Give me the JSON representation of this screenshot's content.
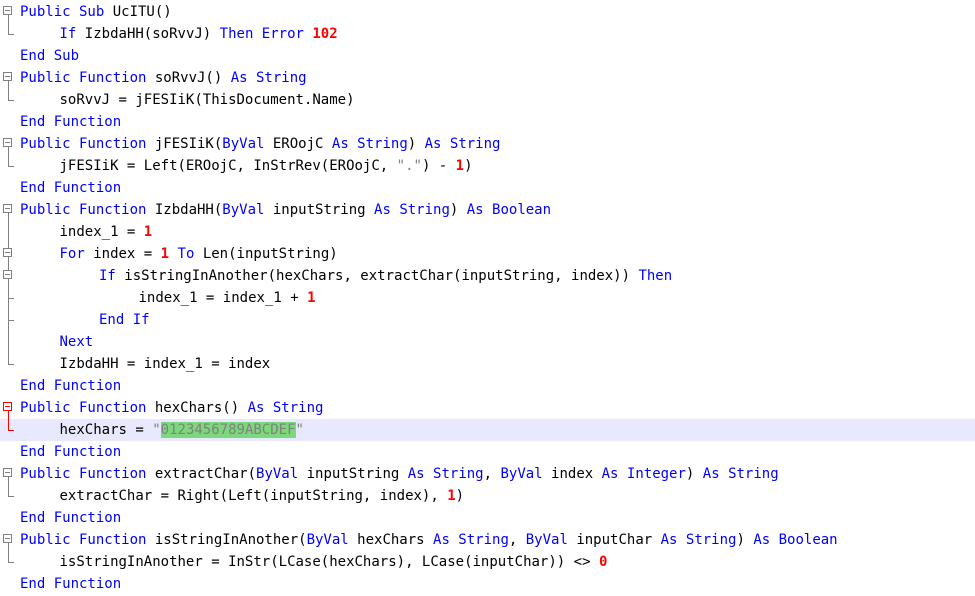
{
  "editor": {
    "lines": [
      {
        "indent": 0,
        "tokens": [
          [
            "kw",
            "Public Sub "
          ],
          [
            "t",
            "UcITU()"
          ]
        ]
      },
      {
        "indent": 1,
        "tokens": [
          [
            "kw",
            "If "
          ],
          [
            "t",
            "IzbdaHH(soRvvJ) "
          ],
          [
            "kw",
            "Then Error "
          ],
          [
            "num",
            "102"
          ]
        ]
      },
      {
        "indent": 0,
        "tokens": [
          [
            "kw",
            "End Sub"
          ]
        ]
      },
      {
        "indent": 0,
        "tokens": [
          [
            "kw",
            "Public Function "
          ],
          [
            "t",
            "soRvvJ() "
          ],
          [
            "kw",
            "As String"
          ]
        ]
      },
      {
        "indent": 1,
        "tokens": [
          [
            "t",
            "soRvvJ = jFESIiK(ThisDocument.Name)"
          ]
        ]
      },
      {
        "indent": 0,
        "tokens": [
          [
            "kw",
            "End Function"
          ]
        ]
      },
      {
        "indent": 0,
        "tokens": [
          [
            "kw",
            "Public Function "
          ],
          [
            "t",
            "jFESIiK("
          ],
          [
            "kw",
            "ByVal "
          ],
          [
            "t",
            "EROojC "
          ],
          [
            "kw",
            "As String"
          ],
          [
            "t",
            ") "
          ],
          [
            "kw",
            "As String"
          ]
        ]
      },
      {
        "indent": 1,
        "tokens": [
          [
            "t",
            "jFESIiK = Left(EROojC, InStrRev(EROojC, "
          ],
          [
            "str",
            "\".\""
          ],
          [
            "t",
            ") - "
          ],
          [
            "num",
            "1"
          ],
          [
            "t",
            ")"
          ]
        ]
      },
      {
        "indent": 0,
        "tokens": [
          [
            "kw",
            "End Function"
          ]
        ]
      },
      {
        "indent": 0,
        "tokens": [
          [
            "kw",
            "Public Function "
          ],
          [
            "t",
            "IzbdaHH("
          ],
          [
            "kw",
            "ByVal "
          ],
          [
            "t",
            "inputString "
          ],
          [
            "kw",
            "As String"
          ],
          [
            "t",
            ") "
          ],
          [
            "kw",
            "As Boolean"
          ]
        ]
      },
      {
        "indent": 1,
        "tokens": [
          [
            "t",
            "index_1 = "
          ],
          [
            "num",
            "1"
          ]
        ]
      },
      {
        "indent": 1,
        "tokens": [
          [
            "kw",
            "For "
          ],
          [
            "t",
            "index = "
          ],
          [
            "num",
            "1"
          ],
          [
            "kw",
            " To "
          ],
          [
            "t",
            "Len(inputString)"
          ]
        ]
      },
      {
        "indent": 2,
        "tokens": [
          [
            "kw",
            "If "
          ],
          [
            "t",
            "isStringInAnother(hexChars, extractChar(inputString, index)) "
          ],
          [
            "kw",
            "Then"
          ]
        ]
      },
      {
        "indent": 3,
        "tokens": [
          [
            "t",
            "index_1 = index_1 + "
          ],
          [
            "num",
            "1"
          ]
        ]
      },
      {
        "indent": 2,
        "tokens": [
          [
            "kw",
            "End If"
          ]
        ]
      },
      {
        "indent": 1,
        "tokens": [
          [
            "kw",
            "Next"
          ]
        ]
      },
      {
        "indent": 1,
        "tokens": [
          [
            "t",
            "IzbdaHH = index_1 = index"
          ]
        ]
      },
      {
        "indent": 0,
        "tokens": [
          [
            "kw",
            "End Function"
          ]
        ]
      },
      {
        "indent": 0,
        "tokens": [
          [
            "kw",
            "Public Function "
          ],
          [
            "t",
            "hexChars() "
          ],
          [
            "kw",
            "As String"
          ]
        ]
      },
      {
        "indent": 1,
        "tokens": [
          [
            "t",
            "hexChars = "
          ],
          [
            "str",
            "\""
          ],
          [
            "sel",
            "0123456789ABCDEF"
          ],
          [
            "str",
            "\""
          ]
        ]
      },
      {
        "indent": 0,
        "tokens": [
          [
            "kw",
            "End Function"
          ]
        ]
      },
      {
        "indent": 0,
        "tokens": [
          [
            "kw",
            "Public Function "
          ],
          [
            "t",
            "extractChar("
          ],
          [
            "kw",
            "ByVal "
          ],
          [
            "t",
            "inputString "
          ],
          [
            "kw",
            "As String"
          ],
          [
            "t",
            ", "
          ],
          [
            "kw",
            "ByVal "
          ],
          [
            "t",
            "index "
          ],
          [
            "kw",
            "As Integer"
          ],
          [
            "t",
            ") "
          ],
          [
            "kw",
            "As String"
          ]
        ]
      },
      {
        "indent": 1,
        "tokens": [
          [
            "t",
            "extractChar = Right(Left(inputString, index), "
          ],
          [
            "num",
            "1"
          ],
          [
            "t",
            ")"
          ]
        ]
      },
      {
        "indent": 0,
        "tokens": [
          [
            "kw",
            "End Function"
          ]
        ]
      },
      {
        "indent": 0,
        "tokens": [
          [
            "kw",
            "Public Function "
          ],
          [
            "t",
            "isStringInAnother("
          ],
          [
            "kw",
            "ByVal "
          ],
          [
            "t",
            "hexChars "
          ],
          [
            "kw",
            "As String"
          ],
          [
            "t",
            ", "
          ],
          [
            "kw",
            "ByVal "
          ],
          [
            "t",
            "inputChar "
          ],
          [
            "kw",
            "As String"
          ],
          [
            "t",
            ") "
          ],
          [
            "kw",
            "As Boolean"
          ]
        ]
      },
      {
        "indent": 1,
        "tokens": [
          [
            "t",
            "isStringInAnother = InStr(LCase(hexChars), LCase(inputChar)) <> "
          ],
          [
            "num",
            "0"
          ]
        ]
      },
      {
        "indent": 0,
        "tokens": [
          [
            "kw",
            "End Function"
          ]
        ]
      }
    ],
    "highlighted_line": 19,
    "colors": {
      "keyword": "#0000ff",
      "number": "#ff0000",
      "string": "#808080",
      "selection": "#7bd87b",
      "current_line": "#e8e8ff",
      "fold_marker": "#808080",
      "fold_marker_active": "#ff0000"
    }
  }
}
